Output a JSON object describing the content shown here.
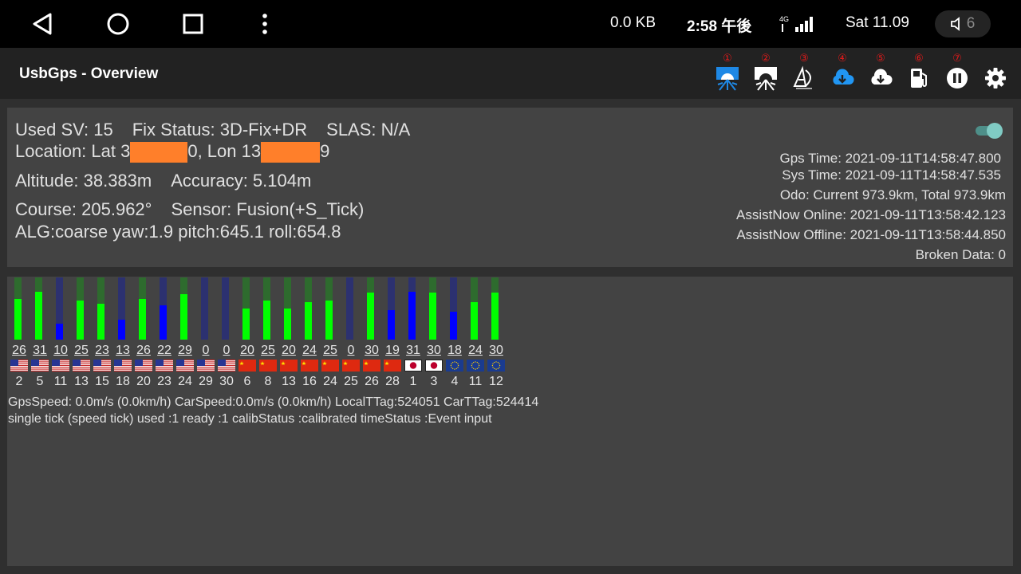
{
  "statusbar": {
    "data_counter": "0.0 KB",
    "time": "2:58 午後",
    "network": "4G",
    "date": "Sat 11.09",
    "volume": "6"
  },
  "appbar": {
    "title": "UsbGps - Overview",
    "tools": [
      {
        "num": "①",
        "icon": "satellite-dish-blue-icon"
      },
      {
        "num": "②",
        "icon": "satellite-dish-white-icon"
      },
      {
        "num": "③",
        "icon": "ad-logo-icon"
      },
      {
        "num": "④",
        "icon": "cloud-download-blue-icon"
      },
      {
        "num": "⑤",
        "icon": "cloud-download-white-icon"
      },
      {
        "num": "⑥",
        "icon": "fuel-pump-icon"
      },
      {
        "num": "⑦",
        "icon": "pause-icon"
      }
    ],
    "settings_icon": "gear-icon"
  },
  "overview": {
    "used_sv": "Used SV: 15",
    "fix_status": "Fix Status: 3D-Fix+DR",
    "slas": "SLAS: N/A",
    "location_prefix": "Location: Lat 3",
    "location_mid": "0, Lon 13",
    "location_suffix": "9",
    "altitude": "Altitude: 38.383m",
    "accuracy": "Accuracy: 5.104m",
    "course": "Course: 205.962°",
    "sensor": "Sensor: Fusion(+S_Tick)",
    "alg": "ALG:coarse yaw:1.9 pitch:645.1 roll:654.8",
    "toggle_on": true
  },
  "times": {
    "gps_time": "Gps Time: 2021-09-11T14:58:47.800",
    "sys_time": "Sys Time: 2021-09-11T14:58:47.535",
    "odo": "Odo: Current 973.9km, Total 973.9km",
    "assist_online": "AssistNow Online: 2021-09-11T13:58:42.123",
    "assist_offline": "AssistNow Offline: 2021-09-11T13:58:44.850",
    "broken": "Broken Data: 0"
  },
  "colors": {
    "used_fill": "#00ff00",
    "used_bg": "#2e6b2e",
    "unused_fill": "#0000ff",
    "unused_bg": "#2c3170",
    "redaction": "#ff7f2a"
  },
  "satellites": [
    {
      "snr": "26",
      "id": "2",
      "used": true,
      "flag": "us"
    },
    {
      "snr": "31",
      "id": "5",
      "used": true,
      "flag": "us"
    },
    {
      "snr": "10",
      "id": "11",
      "used": false,
      "flag": "us"
    },
    {
      "snr": "25",
      "id": "13",
      "used": true,
      "flag": "us"
    },
    {
      "snr": "23",
      "id": "15",
      "used": true,
      "flag": "us"
    },
    {
      "snr": "13",
      "id": "18",
      "used": false,
      "flag": "us"
    },
    {
      "snr": "26",
      "id": "20",
      "used": true,
      "flag": "us"
    },
    {
      "snr": "22",
      "id": "23",
      "used": false,
      "flag": "us"
    },
    {
      "snr": "29",
      "id": "24",
      "used": true,
      "flag": "us"
    },
    {
      "snr": "0",
      "id": "29",
      "used": false,
      "flag": "us"
    },
    {
      "snr": "0",
      "id": "30",
      "used": false,
      "flag": "us"
    },
    {
      "snr": "20",
      "id": "6",
      "used": true,
      "flag": "cn"
    },
    {
      "snr": "25",
      "id": "8",
      "used": true,
      "flag": "cn"
    },
    {
      "snr": "20",
      "id": "13",
      "used": true,
      "flag": "cn"
    },
    {
      "snr": "24",
      "id": "16",
      "used": true,
      "flag": "cn"
    },
    {
      "snr": "25",
      "id": "24",
      "used": true,
      "flag": "cn"
    },
    {
      "snr": "0",
      "id": "25",
      "used": false,
      "flag": "cn"
    },
    {
      "snr": "30",
      "id": "26",
      "used": true,
      "flag": "cn"
    },
    {
      "snr": "19",
      "id": "28",
      "used": false,
      "flag": "cn"
    },
    {
      "snr": "31",
      "id": "1",
      "used": false,
      "flag": "jp"
    },
    {
      "snr": "30",
      "id": "3",
      "used": true,
      "flag": "jp"
    },
    {
      "snr": "18",
      "id": "4",
      "used": false,
      "flag": "eu"
    },
    {
      "snr": "24",
      "id": "11",
      "used": true,
      "flag": "eu"
    },
    {
      "snr": "30",
      "id": "12",
      "used": true,
      "flag": "eu"
    }
  ],
  "speed_line": "GpsSpeed: 0.0m/s (0.0km/h) CarSpeed:0.0m/s (0.0km/h) LocalTTag:524051 CarTTag:524414",
  "tick_line": "single tick (speed tick) used :1 ready :1 calibStatus :calibrated timeStatus :Event input"
}
